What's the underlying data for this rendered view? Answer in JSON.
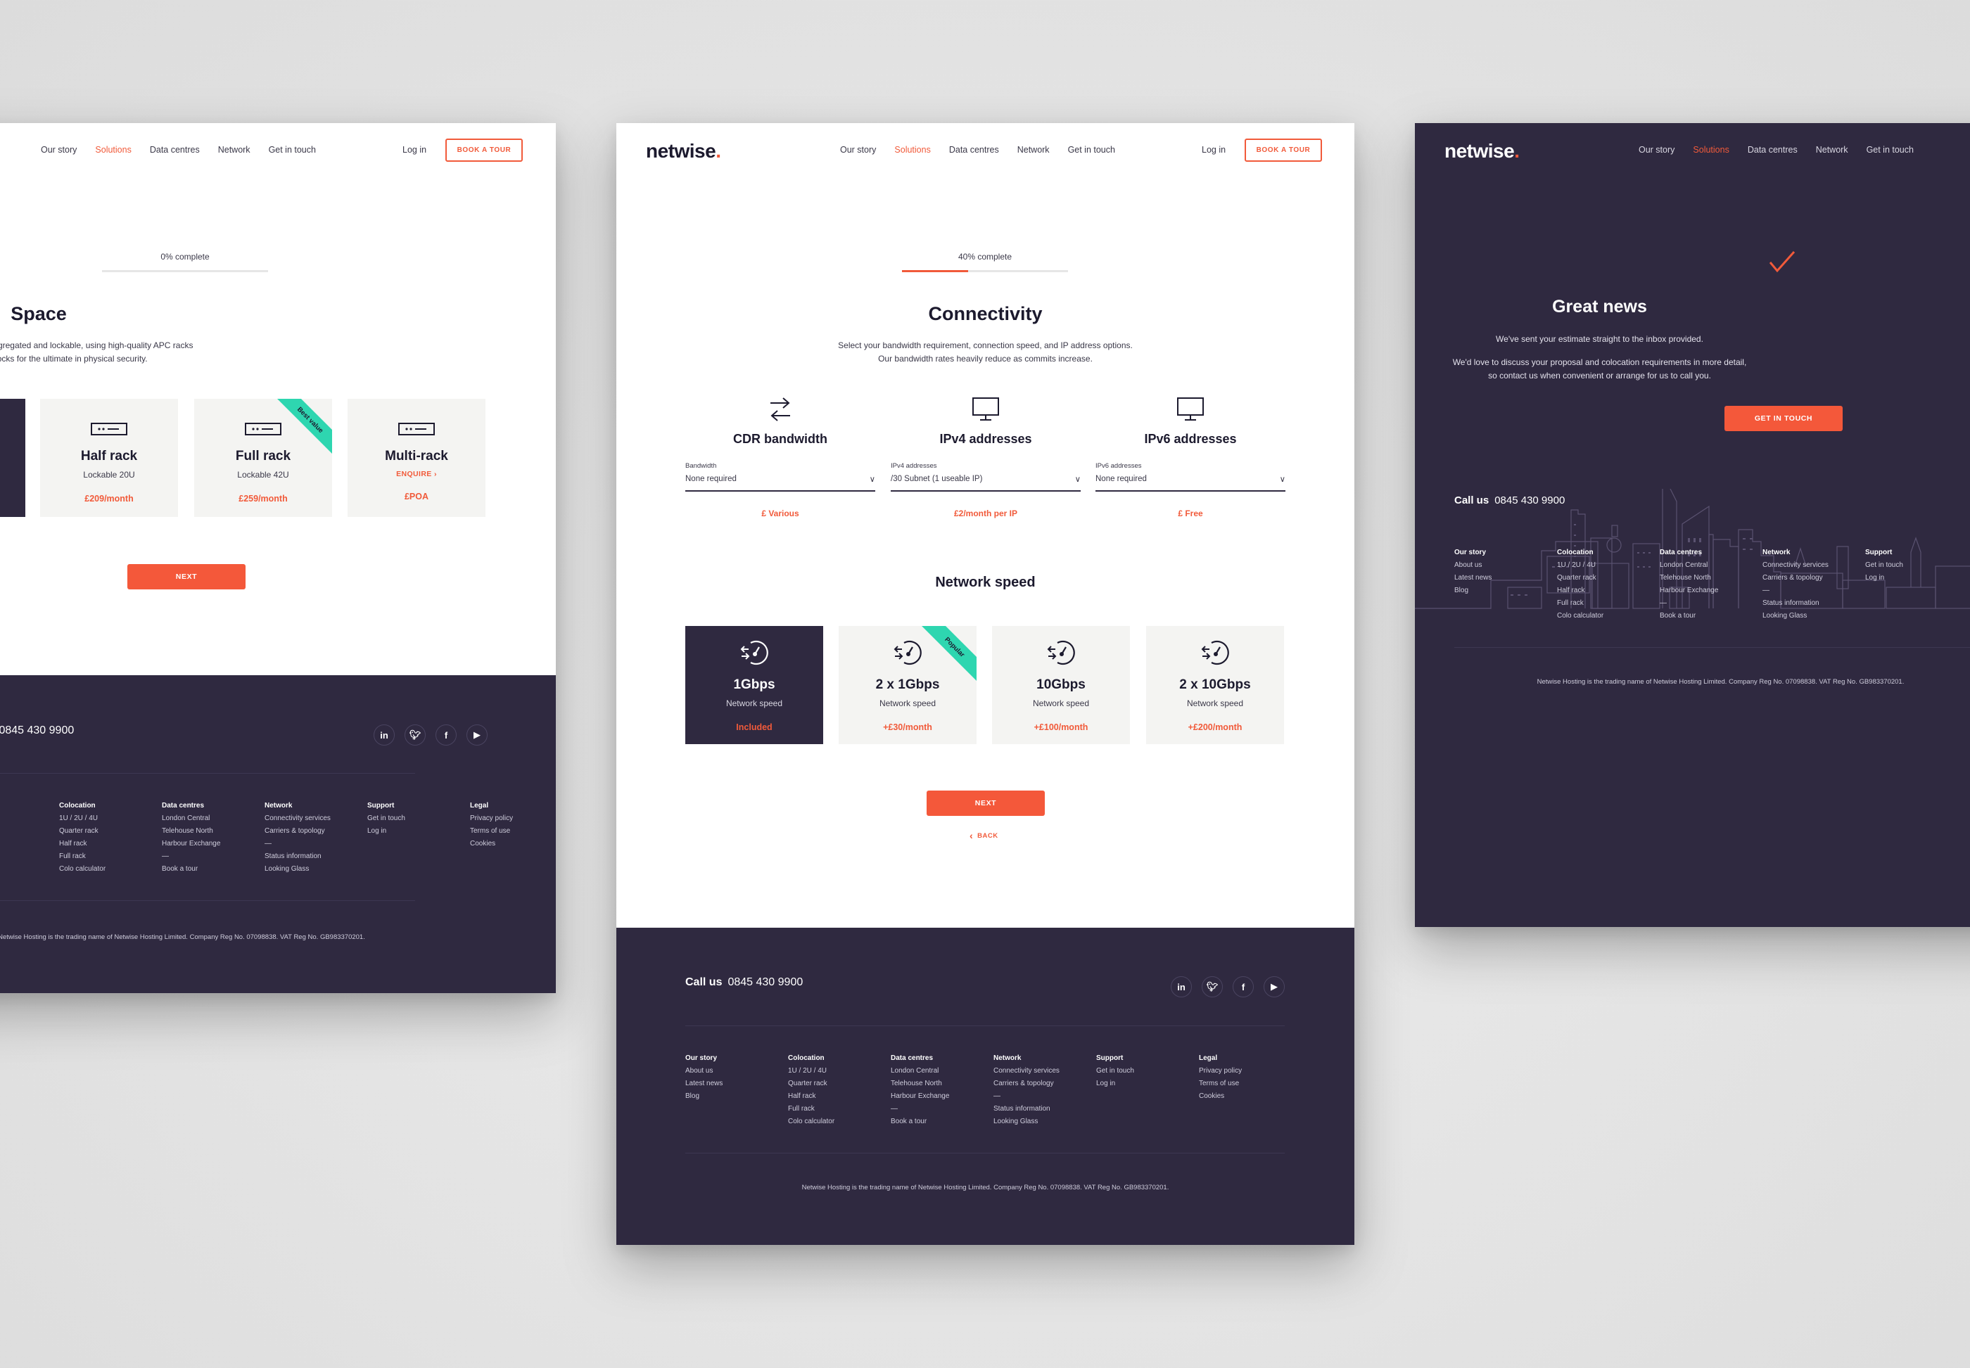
{
  "brand": {
    "logo_text": "netwise",
    "logo_dot": ".",
    "accent_color": "#f15a3a",
    "dark_color": "#2f2940",
    "ribbon_color": "#2ed6b0"
  },
  "nav": {
    "items": [
      "Our story",
      "Solutions",
      "Data centres",
      "Network",
      "Get in touch"
    ],
    "active": "Solutions",
    "login": "Log in",
    "book_tour": "BOOK A TOUR"
  },
  "space_step": {
    "progress_label": "0% complete",
    "progress_percent": 0,
    "title": "Space",
    "description_line1": "All of our space options are segregated and lockable, using high-quality APC racks",
    "description_line2": "with combination locks for the ultimate in physical security.",
    "cards": [
      {
        "title": "Half rack",
        "subtitle": "Lockable 20U",
        "price": "£209/month",
        "icon": "server-rack-icon"
      },
      {
        "title": "Full rack",
        "subtitle": "Lockable 42U",
        "price": "£259/month",
        "icon": "server-rack-icon",
        "ribbon": "Best value"
      },
      {
        "title": "Multi-rack",
        "subtitle": "ENQUIRE",
        "price": "£POA",
        "icon": "server-rack-icon"
      }
    ],
    "next": "NEXT"
  },
  "connectivity_step": {
    "progress_label": "40% complete",
    "progress_percent": 40,
    "title": "Connectivity",
    "description_line1": "Select your bandwidth requirement, connection speed, and IP address options.",
    "description_line2": "Our bandwidth rates heavily reduce as commits increase.",
    "options": [
      {
        "title": "CDR bandwidth",
        "icon": "transfer-arrows-icon",
        "select_label": "Bandwidth",
        "select_value": "None required",
        "price": "£ Various"
      },
      {
        "title": "IPv4 addresses",
        "icon": "monitor-icon",
        "select_label": "IPv4 addresses",
        "select_value": "/30 Subnet (1 useable IP)",
        "price": "£2/month per IP"
      },
      {
        "title": "IPv6 addresses",
        "icon": "monitor-icon",
        "select_label": "IPv6 addresses",
        "select_value": "None required",
        "price": "£ Free"
      }
    ],
    "speed_title": "Network speed",
    "speeds": [
      {
        "title": "1Gbps",
        "subtitle": "Network speed",
        "price": "Included",
        "selected": true
      },
      {
        "title": "2 x 1Gbps",
        "subtitle": "Network speed",
        "price": "+£30/month",
        "ribbon": "Popular"
      },
      {
        "title": "10Gbps",
        "subtitle": "Network speed",
        "price": "+£100/month"
      },
      {
        "title": "2 x 10Gbps",
        "subtitle": "Network speed",
        "price": "+£200/month"
      }
    ],
    "next": "NEXT",
    "back": "BACK"
  },
  "confirmation": {
    "title": "Great news",
    "line1": "We've sent your estimate straight to the inbox provided.",
    "line2": "We'd love to discuss your proposal and colocation requirements in more detail,",
    "line3": "so contact us when convenient or arrange for us to call you.",
    "button": "GET IN TOUCH"
  },
  "footer": {
    "call_label": "Call us",
    "phone": "0845 430 9900",
    "socials": [
      "in",
      "t",
      "f",
      "yt"
    ],
    "columns": [
      {
        "heading": "Our story",
        "links": [
          "About us",
          "Latest news",
          "Blog"
        ]
      },
      {
        "heading": "Colocation",
        "links": [
          "1U / 2U / 4U",
          "Quarter rack",
          "Half rack",
          "Full rack",
          "Colo calculator"
        ]
      },
      {
        "heading": "Data centres",
        "links": [
          "London Central",
          "Telehouse North",
          "Harbour Exchange",
          "—",
          "Book a tour"
        ]
      },
      {
        "heading": "Network",
        "links": [
          "Connectivity services",
          "Carriers & topology",
          "—",
          "Status information",
          "Looking Glass"
        ]
      },
      {
        "heading": "Support",
        "links": [
          "Get in touch",
          "Log in"
        ]
      },
      {
        "heading": "Legal",
        "links": [
          "Privacy policy",
          "Terms of use",
          "Cookies"
        ]
      }
    ],
    "legal": "Netwise Hosting is the trading name of Netwise Hosting Limited. Company Reg No. 07098838. VAT Reg No. GB983370201."
  }
}
